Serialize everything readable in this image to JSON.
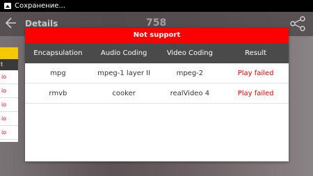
{
  "status_bar": {
    "text": "Сохранение..."
  },
  "header": {
    "title": "Details",
    "center_number": "758"
  },
  "left_panel": {
    "header": "t",
    "items": [
      "io",
      "io",
      "io",
      "io",
      "io"
    ]
  },
  "dialog": {
    "title": "Not support",
    "columns": [
      "Encapsulation",
      "Audio Coding",
      "Video Coding",
      "Result"
    ],
    "rows": [
      {
        "encapsulation": "mpg",
        "audio": "mpeg-1 layer II",
        "video": "mpeg-2",
        "result": "Play failed"
      },
      {
        "encapsulation": "rmvb",
        "audio": "cooker",
        "video": "realVideo 4",
        "result": "Play failed"
      }
    ]
  },
  "colors": {
    "header_red": "#ff0000",
    "table_header": "#4a4a4a",
    "failed_text": "#e00000",
    "accent_yellow": "#f4c900"
  }
}
